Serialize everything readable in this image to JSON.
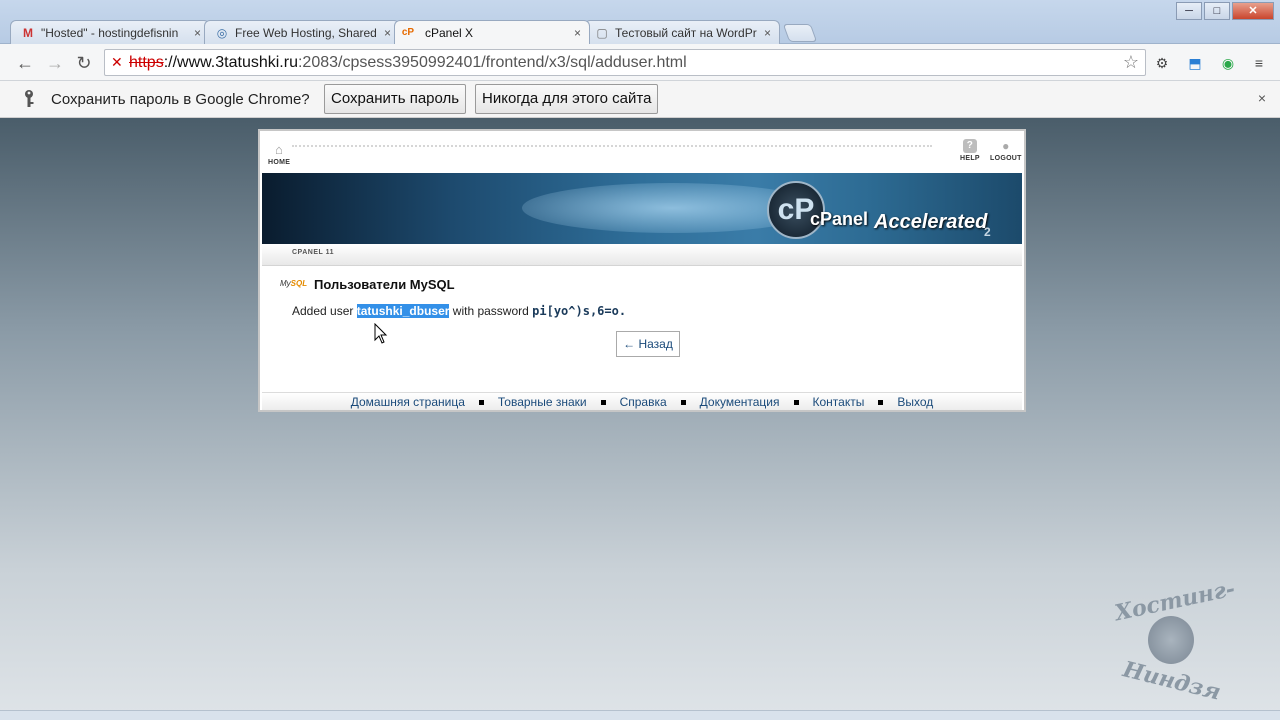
{
  "browser": {
    "tabs": [
      {
        "title": "\"Hosted\" - hostingdefisnin",
        "favicon": "M",
        "active": false
      },
      {
        "title": "Free Web Hosting, Shared",
        "favicon": "◎",
        "active": false
      },
      {
        "title": "cPanel X",
        "favicon": "cP",
        "active": true
      },
      {
        "title": "Тестовый сайт на WordPr",
        "favicon": "▢",
        "active": false
      }
    ],
    "tab_close": "×",
    "window_controls": {
      "minimize": "─",
      "maximize": "□",
      "close": "✕"
    },
    "nav": {
      "back": "←",
      "forward": "→",
      "reload": "↻"
    },
    "url": {
      "scheme": "https",
      "host": "://www.3tatushki.ru",
      "path": ":2083/cpsess3950992401/frontend/x3/sql/adduser.html",
      "security_icon": "✕"
    },
    "star": "☆",
    "extensions": [
      "⚙",
      "⬒",
      "◉",
      "≡"
    ]
  },
  "password_bar": {
    "message": "Сохранить пароль в Google Chrome?",
    "save_label": "Сохранить пароль",
    "never_label": "Никогда для этого сайта",
    "close": "×"
  },
  "cpanel": {
    "top_links": {
      "home": "HOME",
      "help": "HELP",
      "logout": "LOGOUT"
    },
    "brand": {
      "badge": "cP",
      "name": "cPanel",
      "accelerated": "Accelerated",
      "version": "2"
    },
    "version_label": "CPANEL 11",
    "heading": "Пользователи MySQL",
    "mysql_logo": {
      "prefix": "My",
      "suffix": "SQL"
    },
    "result": {
      "prefix": "Added user",
      "username": "tatushki_dbuser",
      "middle": "with password",
      "password": "pi[yo^)s,6=o."
    },
    "back_label": "← Назад",
    "footer": [
      "Домашняя страница",
      "Товарные знаки",
      "Справка",
      "Документация",
      "Контакты",
      "Выход"
    ]
  },
  "watermark": {
    "line1": "Хостинг-",
    "line2": "Ниндзя"
  }
}
